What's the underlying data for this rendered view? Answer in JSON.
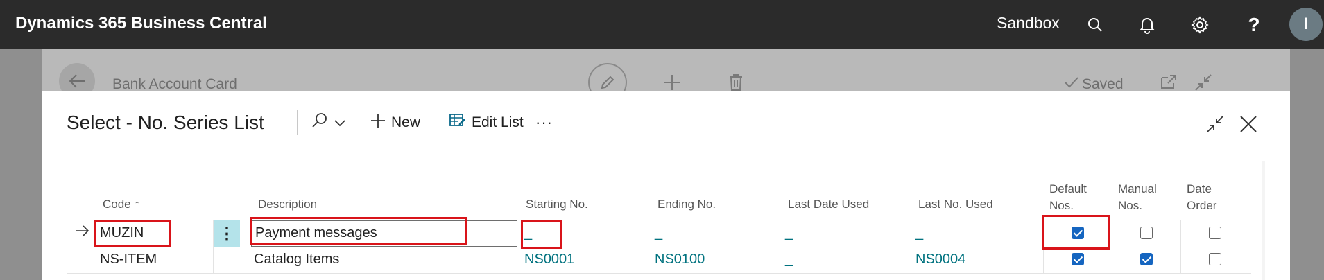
{
  "app": {
    "title": "Dynamics 365 Business Central",
    "environment": "Sandbox",
    "help_glyph": "?",
    "user_initial": "I"
  },
  "background_page": {
    "title": "Bank Account Card",
    "status": "Saved"
  },
  "dialog": {
    "title": "Select - No. Series List",
    "actions": {
      "new_label": "New",
      "edit_list_label": "Edit List",
      "more_label": "···"
    },
    "columns": {
      "code": "Code",
      "sort_indicator": "↑",
      "description": "Description",
      "starting_no": "Starting No.",
      "ending_no": "Ending No.",
      "last_date_used": "Last Date Used",
      "last_no_used": "Last No. Used",
      "default_nos_1": "Default",
      "default_nos_2": "Nos.",
      "manual_nos_1": "Manual",
      "manual_nos_2": "Nos.",
      "date_order_1": "Date",
      "date_order_2": "Order"
    },
    "rows": [
      {
        "code": "MUZIN",
        "description": "Payment messages",
        "starting_no": "_",
        "ending_no": "_",
        "last_date_used": "_",
        "last_no_used": "_",
        "default_nos": true,
        "manual_nos": false,
        "date_order": false,
        "selected": true
      },
      {
        "code": "NS-ITEM",
        "description": "Catalog Items",
        "starting_no": "NS0001",
        "ending_no": "NS0100",
        "last_date_used": "_",
        "last_no_used": "NS0004",
        "default_nos": true,
        "manual_nos": true,
        "date_order": false,
        "selected": false
      }
    ]
  },
  "colors": {
    "topbar": "#2b2b2b",
    "link": "#00727f",
    "highlight_box": "#d9141a",
    "checkbox_on": "#1565c0",
    "row_menu": "#b4e3ea"
  }
}
